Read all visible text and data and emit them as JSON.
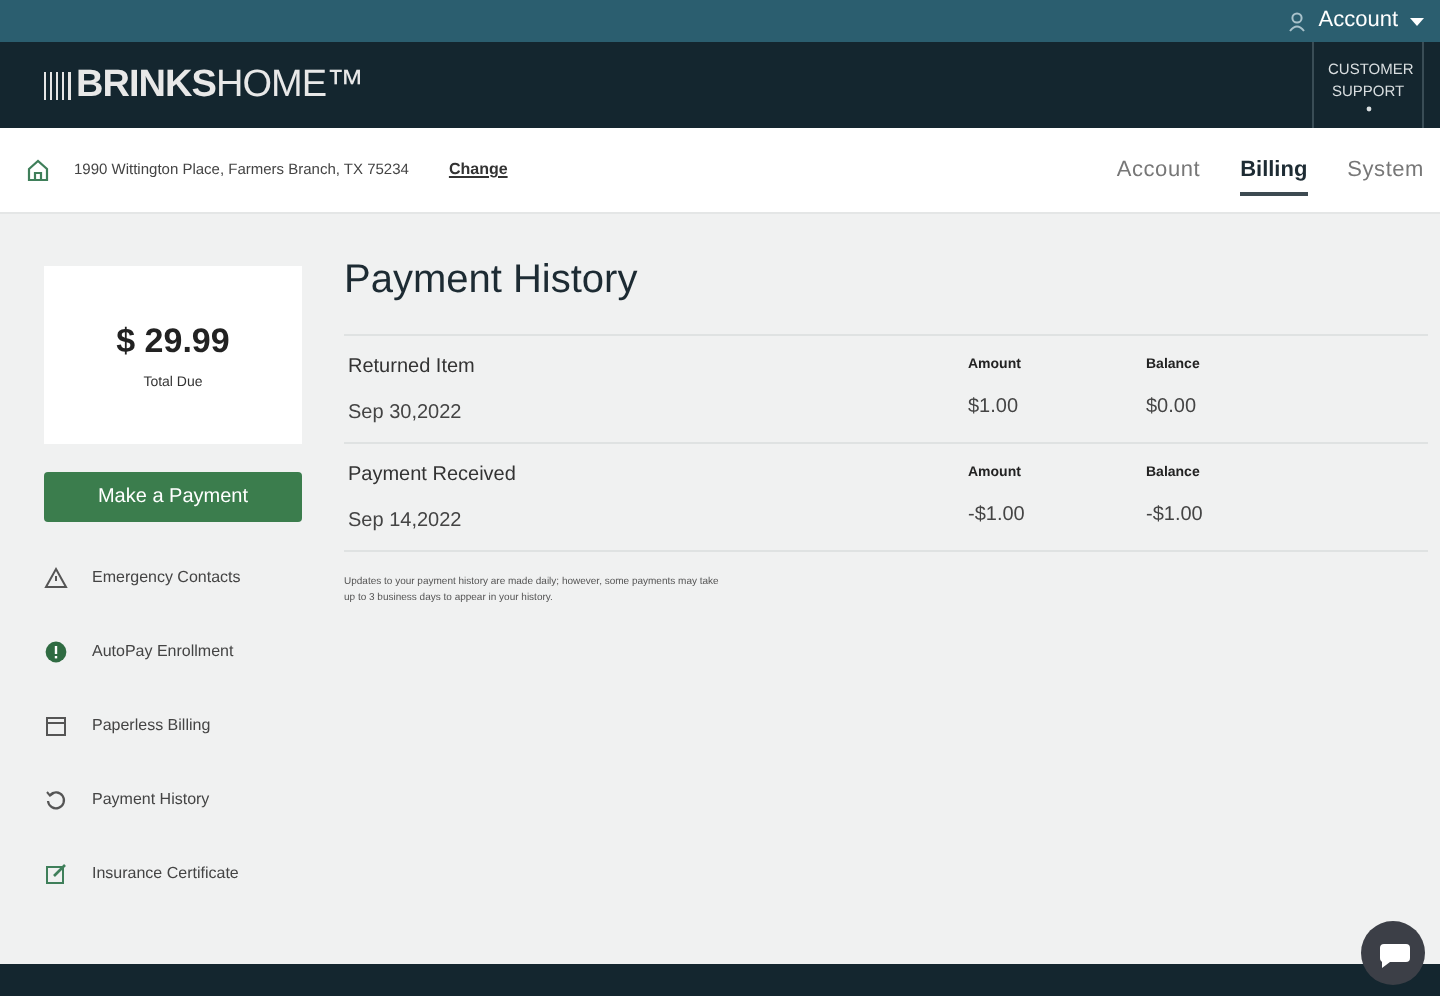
{
  "top_bar": {
    "account_label": "Account"
  },
  "header": {
    "logo": "**BRINKS**HOME™",
    "support_label": "CUSTOMER SUPPORT"
  },
  "nav": {
    "address": "1990 Wittington Place, Farmers Branch, TX 75234",
    "change_link": "Change",
    "tabs": [
      {
        "label": "Account",
        "selected": false
      },
      {
        "label": "Billing",
        "selected": true
      },
      {
        "label": "System",
        "selected": false
      }
    ]
  },
  "summary": {
    "amount": "$ 29.99",
    "label": "Total Due"
  },
  "pay_button": "Make a Payment",
  "sidebar": {
    "items": [
      {
        "label": "Emergency Contacts",
        "kind": "warning"
      },
      {
        "label": "AutoPay Enrollment",
        "kind": "autopay"
      },
      {
        "label": "Paperless Billing",
        "kind": "calendar"
      },
      {
        "label": "Payment History",
        "kind": "history"
      },
      {
        "label": "Insurance Certificate",
        "kind": "edit"
      }
    ]
  },
  "main": {
    "title": "Payment History",
    "rows": [
      {
        "type": "Returned Item",
        "date": "Sep 30,2022",
        "amount_label": "Amount",
        "amount": "$1.00",
        "balance_label": "Balance",
        "balance": "$0.00"
      },
      {
        "type": "Payment Received",
        "date": "Sep 14,2022",
        "amount_label": "Amount",
        "amount": "-$1.00",
        "balance_label": "Balance",
        "balance": "-$1.00"
      }
    ],
    "note": "Updates to your payment history are made daily; however, some payments may take up to 3 business days to appear in your history."
  }
}
